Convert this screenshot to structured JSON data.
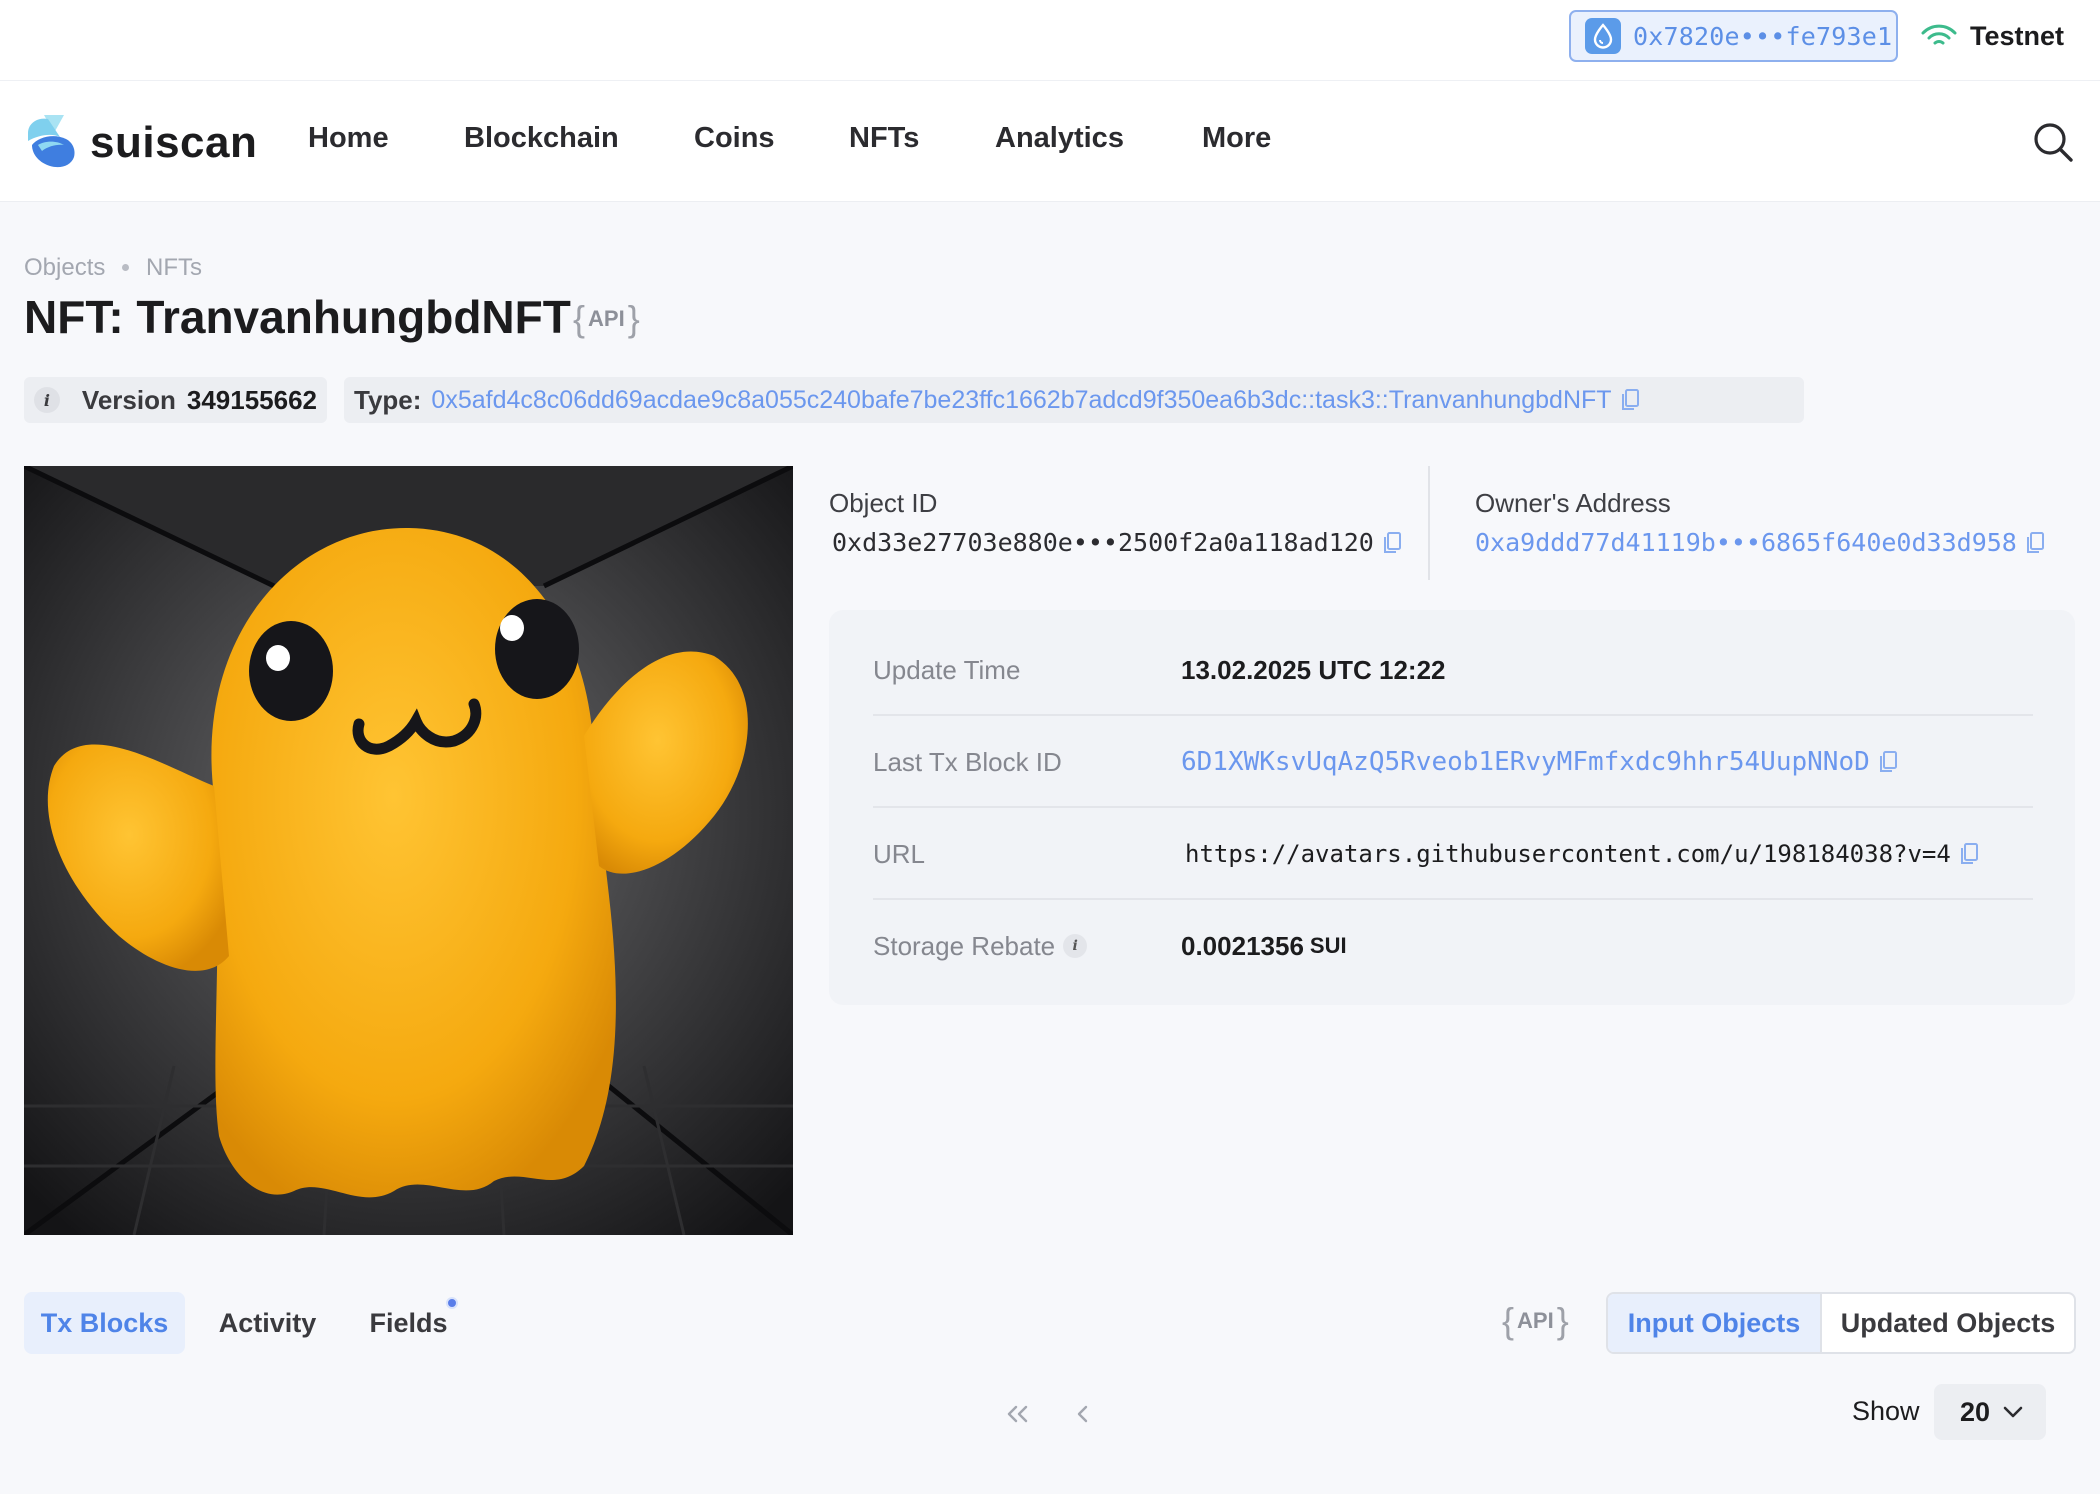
{
  "topbar": {
    "wallet_address": "0x7820e•••fe793e1",
    "network": "Testnet",
    "icons": {
      "wallet": "water-drop-icon",
      "network": "signal-icon"
    },
    "colors": {
      "accent": "#5c8fe6",
      "network_signal": "#3dbb8c"
    }
  },
  "nav": {
    "logo_text": "suiscan",
    "items": [
      "Home",
      "Blockchain",
      "Coins",
      "NFTs",
      "Analytics",
      "More"
    ],
    "search_icon": "search-icon"
  },
  "breadcrumb": [
    "Objects",
    "NFTs"
  ],
  "title": "NFT: TranvanhungbdNFT",
  "api_label": "API",
  "version": {
    "label": "Version",
    "value": "349155662",
    "icon": "info-icon"
  },
  "type": {
    "label": "Type:",
    "value": "0x5afd4c8c06dd69acdae9c8a055c240bafe7be23ffc1662b7adcd9f350ea6b3dc::task3::TranvanhungbdNFT"
  },
  "object": {
    "id_label": "Object ID",
    "id_value": "0xd33e27703e880e•••2500f2a0a118ad120",
    "owner_label": "Owner's Address",
    "owner_value": "0xa9ddd77d41119b•••6865f640e0d33d958"
  },
  "details": [
    {
      "label": "Update Time",
      "value": "13.02.2025 UTC 12:22"
    },
    {
      "label": "Last Tx Block ID",
      "value": "6D1XWKsvUqAzQ5Rveob1ERvyMFmfxdc9hhr54UupNNoD"
    },
    {
      "label": "URL",
      "value": "https://avatars.githubusercontent.com/u/198184038?v=4"
    },
    {
      "label": "Storage Rebate",
      "value": "0.0021356",
      "unit": "SUI"
    }
  ],
  "tabs": [
    "Tx Blocks",
    "Activity",
    "Fields"
  ],
  "api_label_2": "API",
  "segment": {
    "active": "Input Objects",
    "other": "Updated Objects"
  },
  "pagination": {
    "show_label": "Show",
    "page_size": "20"
  }
}
